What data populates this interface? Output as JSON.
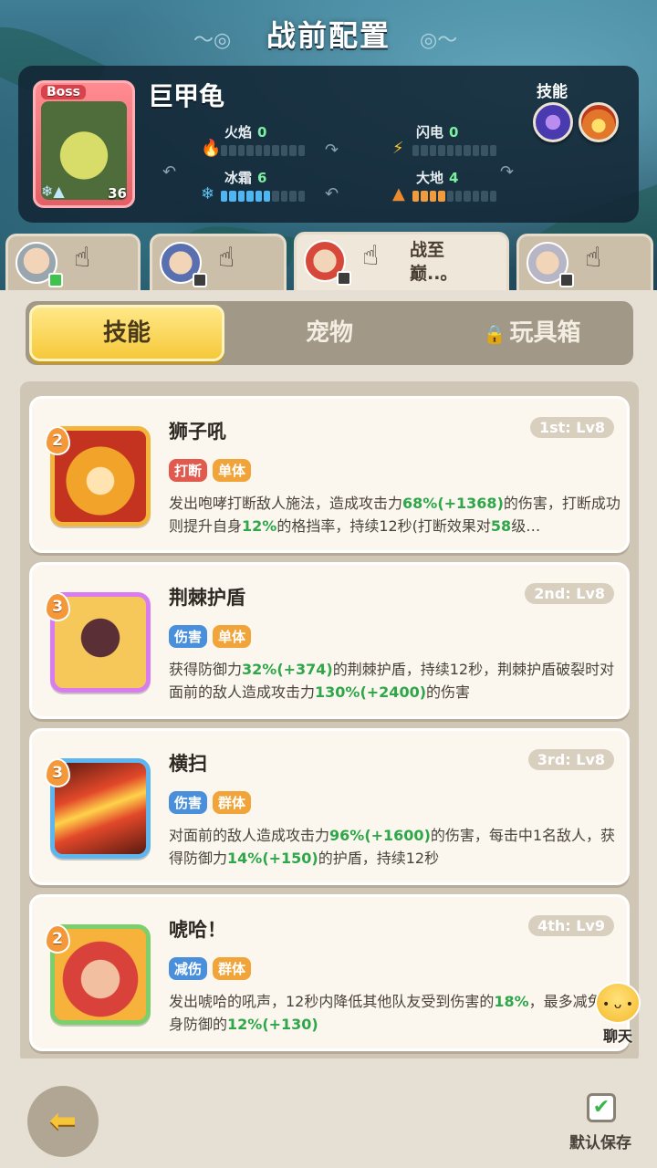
{
  "page": {
    "title": "战前配置"
  },
  "boss": {
    "tag": "Boss",
    "name": "巨甲龟",
    "level": "36",
    "stats": {
      "fire": {
        "label": "火焰",
        "value": "0",
        "level": 0
      },
      "lightning": {
        "label": "闪电",
        "value": "0",
        "level": 0
      },
      "frost": {
        "label": "冰霜",
        "value": "6",
        "level": 6
      },
      "earth": {
        "label": "大地",
        "value": "4",
        "level": 4
      }
    },
    "skills_label": "技能"
  },
  "heroes": [
    {
      "name": "",
      "status": "green"
    },
    {
      "name": "",
      "status": "dark"
    },
    {
      "name": "战至巅..。",
      "status": "dark",
      "active": true
    },
    {
      "name": "",
      "status": "dark"
    }
  ],
  "tabs": {
    "skills": "技能",
    "pets": "宠物",
    "toybox": "玩具箱",
    "active": "skills"
  },
  "skills": [
    {
      "name": "狮子吼",
      "slot": "1st: Lv8",
      "cost": "2",
      "tags": [
        "打断",
        "单体"
      ],
      "desc": [
        "发出咆哮打断敌人施法，造成攻击力",
        "68%",
        "(+1368)",
        "的伤害，打断成功则提升自身",
        "12%",
        "的格挡率，持续12秒(打断效果对",
        "58",
        "级…"
      ]
    },
    {
      "name": "荆棘护盾",
      "slot": "2nd: Lv8",
      "cost": "3",
      "tags": [
        "伤害",
        "单体"
      ],
      "desc": [
        "获得防御力",
        "32%",
        "(+374)",
        "的荆棘护盾，持续12秒，荆棘护盾破裂时对面前的敌人造成攻击力",
        "130%",
        "(+2400)",
        "的伤害"
      ]
    },
    {
      "name": "横扫",
      "slot": "3rd: Lv8",
      "cost": "3",
      "tags": [
        "伤害",
        "群体"
      ],
      "desc": [
        "对面前的敌人造成攻击力",
        "96%",
        "(+1600)",
        "的伤害，每击中1名敌人，获得防御力",
        "14%",
        "(+150)",
        "的护盾，持续12秒"
      ]
    },
    {
      "name": "唬哈！",
      "slot": "4th: Lv9",
      "cost": "2",
      "tags": [
        "减伤",
        "群体"
      ],
      "desc": [
        "发出唬哈的吼声，12秒内降低其他队友受到伤害的",
        "18%",
        "，最多减免自身防御的",
        "12%",
        "(+130)"
      ]
    }
  ],
  "chat": {
    "label": "聊天"
  },
  "footer": {
    "save_label": "默认保存"
  },
  "colors": {
    "tag_red": "#e25a4e",
    "tag_orange": "#f0a43a",
    "tag_blue": "#4a8fdc",
    "num_green": "#2ea64a",
    "tab_active": "#f6c93a"
  }
}
